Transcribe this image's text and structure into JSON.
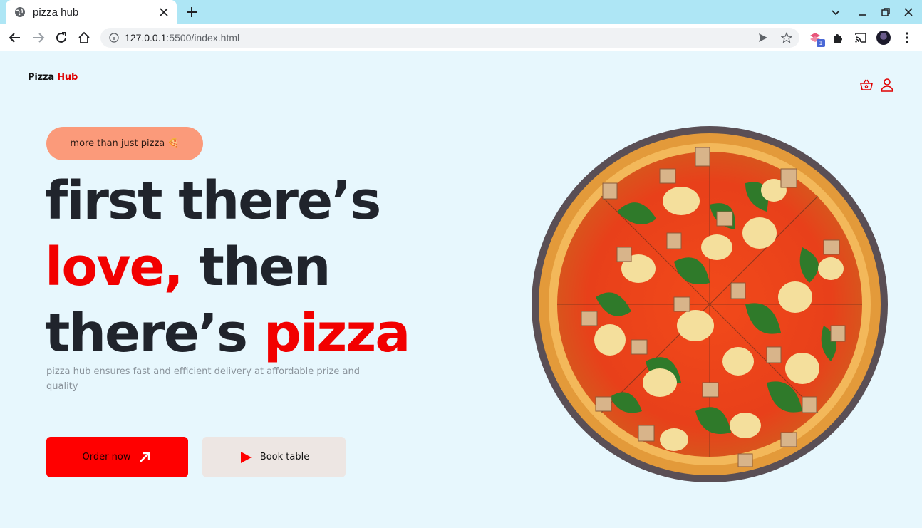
{
  "browser": {
    "tab_title": "pizza hub",
    "url_host": "127.0.0.1",
    "url_rest": ":5500/index.html",
    "extension_badge": "1"
  },
  "site": {
    "logo_part1": "Pizza",
    "logo_part2": "Hub",
    "tagline_pill": "more than just pizza 🍕",
    "headline": {
      "line1": "first there’s",
      "line2_red": "love,",
      "line2_rest": " then",
      "line3_start": "there’s ",
      "line3_red": "pizza"
    },
    "subtext": "pizza hub ensures fast and efficient delivery at affordable prize and quality",
    "order_button": "Order now",
    "book_button": "Book table"
  },
  "colors": {
    "accent_red": "#f20000",
    "pill_bg": "#fb9a7a",
    "page_bg": "#e7f7fd",
    "tab_strip": "#aee6f5"
  },
  "icons": {
    "cart": "basket-icon",
    "user": "user-icon",
    "order_arrow": "arrow-up-right-icon",
    "book_play": "play-icon"
  }
}
